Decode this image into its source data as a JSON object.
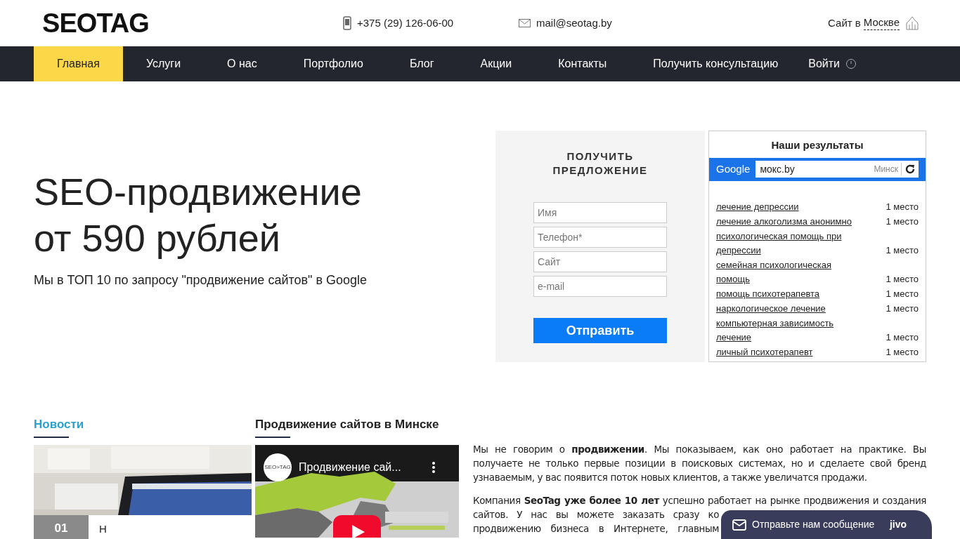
{
  "header": {
    "logo": "SEOTAG",
    "phone": "+375 (29) 126-06-00",
    "email": "mail@seotag.by",
    "city_label": "Сайт в",
    "city": "Москве"
  },
  "nav": [
    {
      "label": "Главная",
      "selected": true
    },
    {
      "label": "Услуги",
      "selected": false
    },
    {
      "label": "О нас",
      "selected": false
    },
    {
      "label": "Портфолио",
      "selected": false
    },
    {
      "label": "Блог",
      "selected": false
    },
    {
      "label": "Акции",
      "selected": false
    },
    {
      "label": "Контакты",
      "selected": false
    },
    {
      "label": "Получить консультацию",
      "selected": false
    }
  ],
  "login": "Войти",
  "hero": {
    "title_lines": [
      "SEO-продвижение",
      "от 590 рублей"
    ],
    "subtitle": "Мы в ТОП 10 по запросу \"продвижение сайтов\" в Google"
  },
  "offer_form": {
    "title": "ПОЛУЧИТЬ ПРЕДЛОЖЕНИЕ",
    "fields": [
      {
        "placeholder": "Имя"
      },
      {
        "placeholder": "Телефон*"
      },
      {
        "placeholder": "Сайт"
      },
      {
        "placeholder": "e-mail"
      }
    ],
    "submit": "Отправить"
  },
  "results": {
    "title": "Наши результаты",
    "engine": "Google",
    "query": "мокс.by",
    "region": "Минск",
    "rows": [
      {
        "query": "лечение депрессии",
        "position": "1 место"
      },
      {
        "query": "лечение алкоголизма анонимно",
        "position": "1 место"
      },
      {
        "query": "психологическая помощь при депрессии",
        "position": "1 место"
      },
      {
        "query": "семейная психологическая помощь",
        "position": "1 место"
      },
      {
        "query": "помощь психотерапевта",
        "position": "1 место"
      },
      {
        "query": "наркологическое лечение",
        "position": "1 место"
      },
      {
        "query": "компьютерная зависимость лечение",
        "position": "1 место"
      },
      {
        "query": "личный психотерапевт",
        "position": "1 место"
      }
    ]
  },
  "news": {
    "title": "Новости",
    "date": "01",
    "headline": "Н"
  },
  "video_section": {
    "title": "Продвижение сайтов в Минске",
    "channel": "SEO>TAG",
    "video_title": "Продвижение сай..."
  },
  "text": {
    "paragraph_1": "Мы не говорим о **продвижении**. Мы показываем, как оно работает на практике. Вы получаете не только первые позиции в поисковых системах, но и сделаете свой бренд узнаваемым, у вас появится поток новых клиентов, а также увеличатся продажи.",
    "paragraph_2_lines": [
      "Компания **SeoTag уже более 10 лет** успешно работает на рынке продвижения и создания",
      "сайтов. У нас вы можете заказать сразу ко",
      "продвижению бизнеса в Интернете, главным"
    ]
  },
  "chat": {
    "label": "Отправьте нам сообщение",
    "brand": "jivo"
  }
}
